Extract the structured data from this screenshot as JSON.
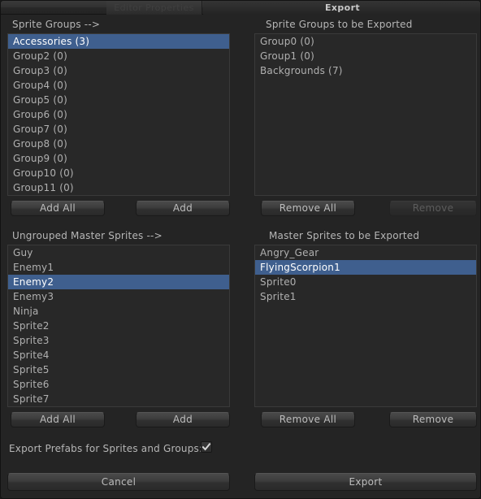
{
  "window": {
    "inactive_tab_label": "Editor Properties",
    "active_tab_label": "Export"
  },
  "colors": {
    "selection": "#3f5f8e",
    "background": "#242424",
    "listbox_background": "#282828",
    "text": "#b0b0b0",
    "text_disabled": "#5c5c5c"
  },
  "sprite_groups": {
    "heading": "Sprite Groups -->",
    "items": [
      {
        "label": "Accessories (3)",
        "selected": true
      },
      {
        "label": "Group2 (0)",
        "selected": false
      },
      {
        "label": "Group3 (0)",
        "selected": false
      },
      {
        "label": "Group4 (0)",
        "selected": false
      },
      {
        "label": "Group5 (0)",
        "selected": false
      },
      {
        "label": "Group6 (0)",
        "selected": false
      },
      {
        "label": "Group7 (0)",
        "selected": false
      },
      {
        "label": "Group8 (0)",
        "selected": false
      },
      {
        "label": "Group9 (0)",
        "selected": false
      },
      {
        "label": "Group10 (0)",
        "selected": false
      },
      {
        "label": "Group11 (0)",
        "selected": false
      }
    ],
    "add_all_label": "Add All",
    "add_label": "Add"
  },
  "sprite_groups_export": {
    "heading": "Sprite Groups to be Exported",
    "items": [
      {
        "label": "Group0 (0)",
        "selected": false
      },
      {
        "label": "Group1 (0)",
        "selected": false
      },
      {
        "label": "Backgrounds (7)",
        "selected": false
      }
    ],
    "remove_all_label": "Remove All",
    "remove_label": "Remove",
    "remove_disabled": true
  },
  "master_sprites": {
    "heading": "Ungrouped Master Sprites -->",
    "items": [
      {
        "label": "Guy",
        "selected": false
      },
      {
        "label": "Enemy1",
        "selected": false
      },
      {
        "label": "Enemy2",
        "selected": true
      },
      {
        "label": "Enemy3",
        "selected": false
      },
      {
        "label": "Ninja",
        "selected": false
      },
      {
        "label": "Sprite2",
        "selected": false
      },
      {
        "label": "Sprite3",
        "selected": false
      },
      {
        "label": "Sprite4",
        "selected": false
      },
      {
        "label": "Sprite5",
        "selected": false
      },
      {
        "label": "Sprite6",
        "selected": false
      },
      {
        "label": "Sprite7",
        "selected": false
      }
    ],
    "add_all_label": "Add All",
    "add_label": "Add"
  },
  "master_sprites_export": {
    "heading": "Master Sprites to be Exported",
    "items": [
      {
        "label": "Angry_Gear",
        "selected": false
      },
      {
        "label": "FlyingScorpion1",
        "selected": true
      },
      {
        "label": "Sprite0",
        "selected": false
      },
      {
        "label": "Sprite1",
        "selected": false
      }
    ],
    "remove_all_label": "Remove All",
    "remove_label": "Remove",
    "remove_disabled": false
  },
  "options": {
    "export_prefabs_label": "Export Prefabs for Sprites and Groups:",
    "export_prefabs_checked": true
  },
  "footer": {
    "cancel_label": "Cancel",
    "export_label": "Export"
  }
}
